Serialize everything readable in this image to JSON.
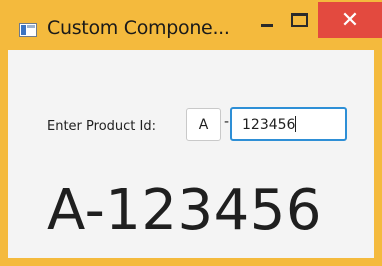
{
  "window": {
    "title": "Custom Compone...",
    "minimize_glyph": "–",
    "close_glyph": "✕"
  },
  "form": {
    "label": "Enter Product Id:",
    "prefix_value": "A",
    "separator": "-",
    "number_value": "123456"
  },
  "output": {
    "text": "A-123456"
  },
  "colors": {
    "window_border": "#f4ba3d",
    "close_button": "#e34a3f",
    "focus_border": "#2e8fd6"
  }
}
